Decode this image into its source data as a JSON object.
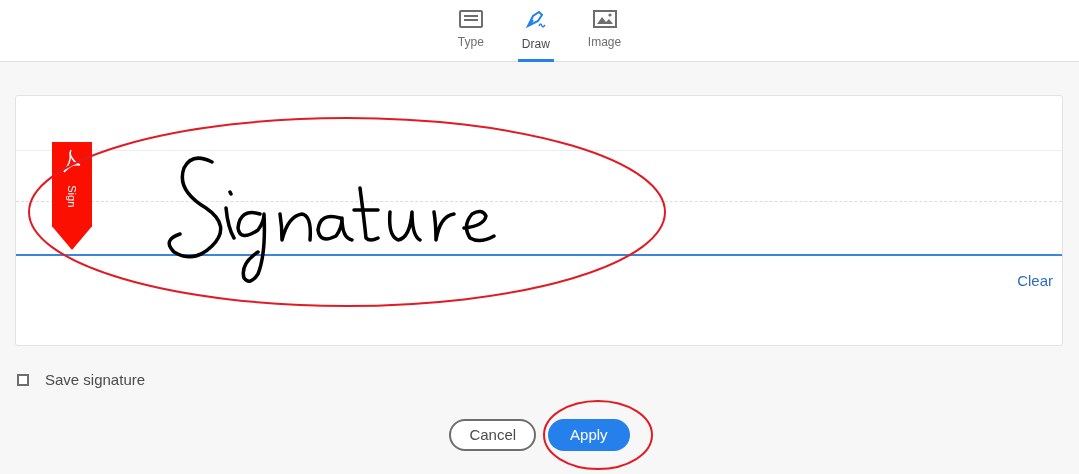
{
  "tabs": [
    {
      "label": "Type",
      "kind": "keyboard",
      "selected": false
    },
    {
      "label": "Draw",
      "kind": "pen",
      "selected": true
    },
    {
      "label": "Image",
      "kind": "image",
      "selected": false
    }
  ],
  "sign_flag": {
    "label": "Sign"
  },
  "clear_link": "Clear",
  "save_signature": {
    "label": "Save signature",
    "checked": false
  },
  "buttons": [
    {
      "label": "Cancel",
      "kind": "secondary",
      "circled": false
    },
    {
      "label": "Apply",
      "kind": "primary",
      "circled": true
    }
  ],
  "signature_circled": true
}
